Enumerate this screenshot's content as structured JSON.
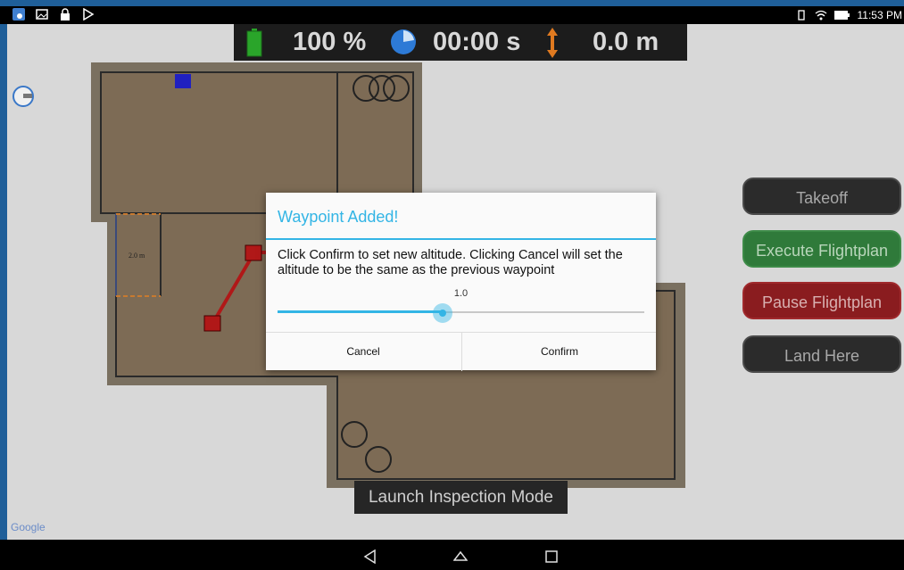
{
  "hud": {
    "battery_text": "100 %",
    "timer_text": "00:00 s",
    "altitude_text": "0.0 m"
  },
  "status_bar": {
    "time": "11:53 PM"
  },
  "map": {
    "scale_label": "2.0 m",
    "google_label": "Google"
  },
  "side_buttons": {
    "takeoff": "Takeoff",
    "execute": "Execute Flightplan",
    "pause": "Pause Flightplan",
    "land": "Land Here"
  },
  "launch_inspection": "Launch Inspection Mode",
  "dialog": {
    "title": "Waypoint Added!",
    "message": "Click Confirm to set new altitude. Clicking Cancel will set the altitude to be the same as the previous waypoint",
    "slider_value": "1.0",
    "slider_fraction": 0.45,
    "cancel": "Cancel",
    "confirm": "Confirm"
  },
  "colors": {
    "accent": "#33b5e5",
    "green_button": "#2f7a3a",
    "red_button": "#8a1c1f"
  }
}
